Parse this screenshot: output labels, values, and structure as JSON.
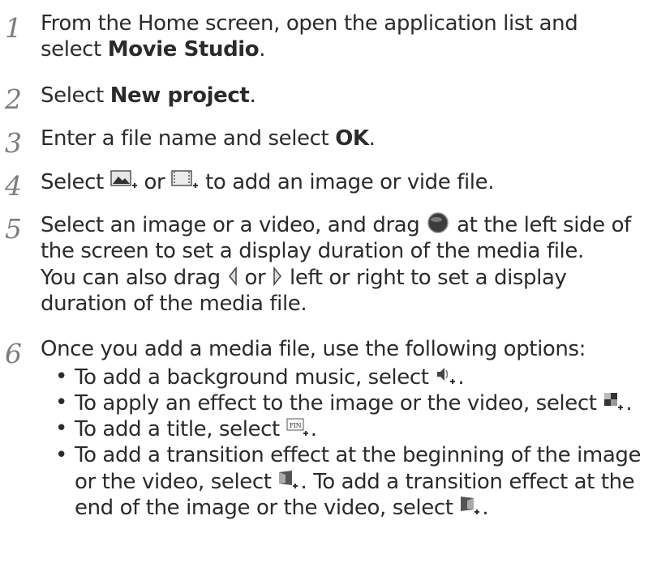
{
  "steps": [
    {
      "num": "1",
      "l1": "From the Home screen, open the application list and",
      "l2a": "select ",
      "l2b": "Movie Studio",
      "l2c": "."
    },
    {
      "num": "2",
      "a": "Select ",
      "b": "New project",
      "c": "."
    },
    {
      "num": "3",
      "a": "Enter a file name and select ",
      "b": "OK",
      "c": "."
    },
    {
      "num": "4",
      "a": "Select ",
      "mid": " or ",
      "c": " to add an image or vide file."
    },
    {
      "num": "5",
      "l1a": "Select an image or a video, and drag ",
      "l1b": " at the left side of",
      "l2": "the screen to set a display duration of the media file.",
      "l3a": "You can also drag ",
      "l3b": " or ",
      "l3c": " left or right to set a display",
      "l4": "duration of the media file."
    },
    {
      "num": "6",
      "intro": "Once you add a media file, use the following options:",
      "bullets": [
        {
          "a": "To add a background music, select ",
          "c": "."
        },
        {
          "a": "To apply an effect to the image or the video, select ",
          "c": "."
        },
        {
          "a": "To add a title, select ",
          "c": "."
        },
        {
          "l1": "To add a transition effect at the beginning of the image",
          "l2a": "or the video, select ",
          "l2b": ". To add a transition effect at the",
          "l3a": "end of the image or the video, select ",
          "l3b": "."
        }
      ]
    }
  ],
  "icons": {
    "bullet": "•",
    "title_icon_text": "FIN"
  }
}
